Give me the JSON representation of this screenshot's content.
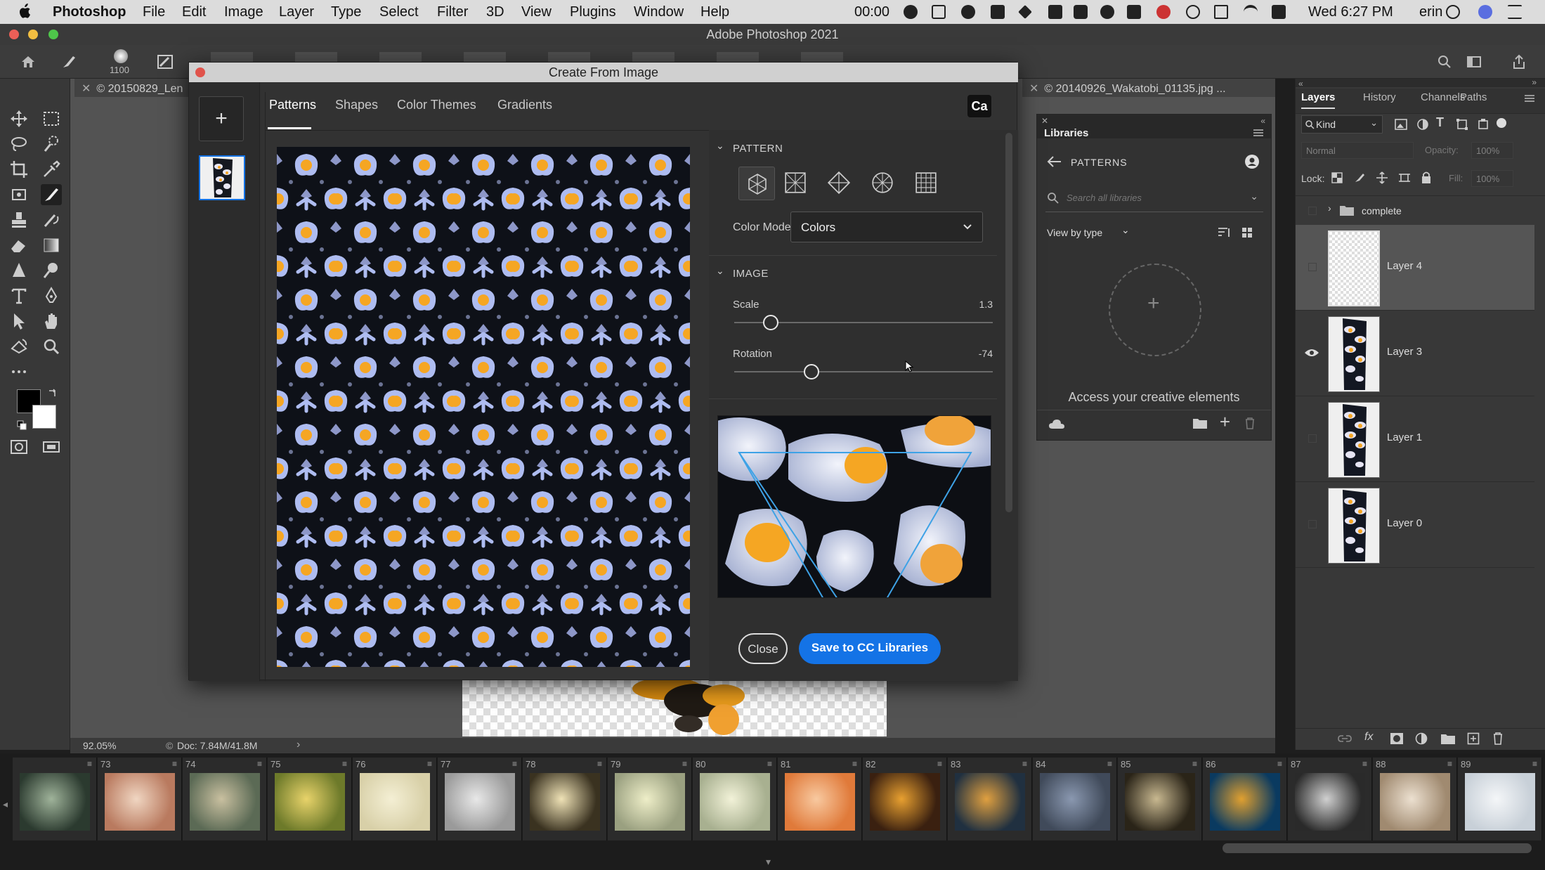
{
  "menubar": {
    "app": "Photoshop",
    "items": [
      "File",
      "Edit",
      "Image",
      "Layer",
      "Type",
      "Select",
      "Filter",
      "3D",
      "View",
      "Plugins",
      "Window",
      "Help"
    ],
    "clock_timer": "00:00",
    "datetime": "Wed 6:27 PM",
    "user": "erin"
  },
  "window": {
    "title": "Adobe Photoshop 2021"
  },
  "options_bar": {
    "brush_size": "1100"
  },
  "documents": {
    "left_tab": "© 20150829_Len",
    "right_tab": "© 20140926_Wakatobi_01135.jpg ..."
  },
  "status": {
    "zoom": "92.05%",
    "doc": "Doc: 7.84M/41.8M"
  },
  "dialog": {
    "title": "Create From Image",
    "add_label": "+",
    "tabs": [
      "Patterns",
      "Shapes",
      "Color Themes",
      "Gradients"
    ],
    "active_tab": "Patterns",
    "badge": "Ca",
    "pattern_section": "PATTERN",
    "color_mode_label": "Color Mode",
    "color_mode_value": "Colors",
    "image_section": "IMAGE",
    "scale_label": "Scale",
    "scale_value": "1.3",
    "scale_fraction": 0.14,
    "rotation_label": "Rotation",
    "rotation_value": "-74",
    "rotation_fraction": 0.3,
    "close_button": "Close",
    "save_button": "Save to CC Libraries"
  },
  "libraries": {
    "title": "Libraries",
    "section": "PATTERNS",
    "search_placeholder": "Search all libraries",
    "view_by": "View by type",
    "empty_text": "Access your creative elements"
  },
  "layers_panel": {
    "tabs": [
      "Layers",
      "History",
      "Channels",
      "Paths"
    ],
    "filter_kind": "Kind",
    "blend_mode": "Normal",
    "opacity_label": "Opacity:",
    "opacity_value": "100%",
    "lock_label": "Lock:",
    "fill_label": "Fill:",
    "fill_value": "100%",
    "group_name": "complete",
    "layers": [
      "Layer 4",
      "Layer 3",
      "Layer 1",
      "Layer 0"
    ]
  },
  "filmstrip": {
    "numbers": [
      "",
      "73",
      "74",
      "75",
      "76",
      "77",
      "78",
      "79",
      "80",
      "81",
      "82",
      "83",
      "84",
      "85",
      "86",
      "87",
      "88",
      "89"
    ]
  },
  "colors": {
    "accent": "#1473e6",
    "pattern_dark": "#0e1118",
    "pattern_light": "#aebcf0",
    "pattern_orange": "#f5a623"
  }
}
